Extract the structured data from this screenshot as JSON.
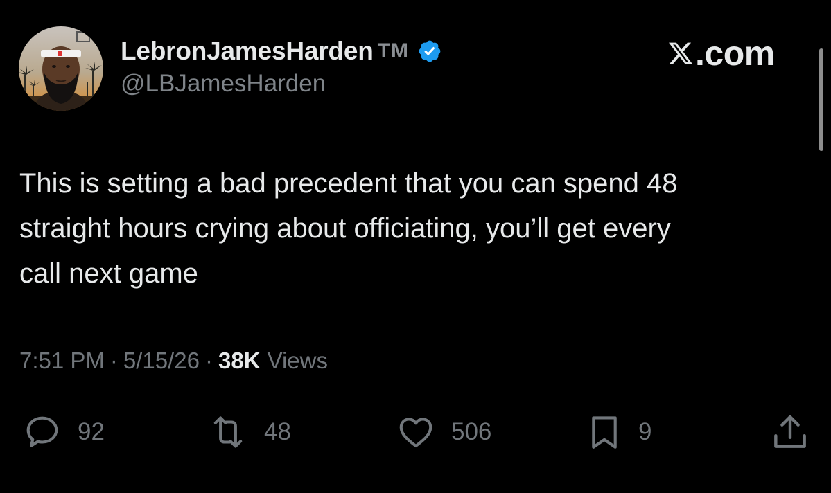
{
  "author": {
    "display_name": "LebronJamesHarden",
    "tm": "TM",
    "handle": "@LBJamesHarden",
    "verified": true,
    "avatar_icon": "avatar-photo"
  },
  "brand": {
    "text": ".com",
    "icon": "x-logo-icon"
  },
  "tweet": {
    "lines": [
      "This is setting a bad precedent that you can spend 48",
      "straight hours crying about officiating, you’ll get every",
      "call next game"
    ]
  },
  "meta": {
    "time": "7:51 PM",
    "separator": "·",
    "date": "5/15/26",
    "views_count": "38K",
    "views_label": "Views"
  },
  "actions": {
    "reply": {
      "icon": "reply-icon",
      "count": "92"
    },
    "retweet": {
      "icon": "retweet-icon",
      "count": "48"
    },
    "like": {
      "icon": "heart-icon",
      "count": "506"
    },
    "bookmark": {
      "icon": "bookmark-icon",
      "count": "9"
    },
    "share": {
      "icon": "share-icon"
    }
  },
  "colors": {
    "background": "#000000",
    "primary_text": "#e7e9ea",
    "secondary_text": "#71767b",
    "verified_badge": "#1d9bf0"
  }
}
